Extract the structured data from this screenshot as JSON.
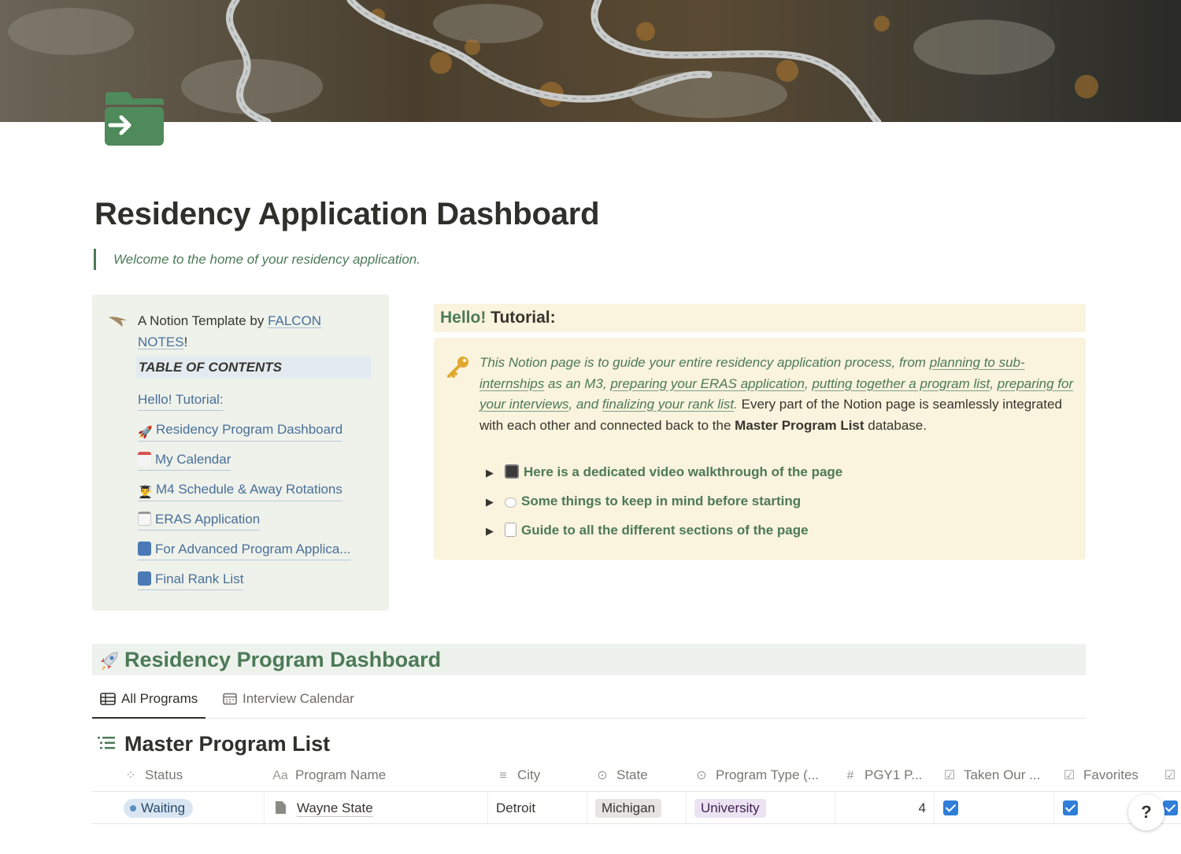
{
  "page": {
    "title": "Residency Application Dashboard",
    "quote": "Welcome to the home of your residency application."
  },
  "toc": {
    "credit_prefix": "A Notion Template by ",
    "credit_link": "FALCON NOTES",
    "credit_suffix": "!",
    "heading": "TABLE OF CONTENTS",
    "items": [
      {
        "label": "Hello! Tutorial:",
        "icon": ""
      },
      {
        "label": "Residency Program Dashboard",
        "icon": "rocket-icon"
      },
      {
        "label": "My Calendar",
        "icon": "calendar-icon"
      },
      {
        "label": "M4 Schedule & Away Rotations",
        "icon": "student-icon"
      },
      {
        "label": "ERAS Application",
        "icon": "notepad-icon"
      },
      {
        "label": "For Advanced Program Applica...",
        "icon": "bar-chart-icon"
      },
      {
        "label": "Final Rank List",
        "icon": "numbers-icon"
      }
    ]
  },
  "tutorial": {
    "heading_green": "Hello!",
    "heading_rest": " Tutorial:",
    "callout": {
      "intro": "This Notion page is to guide your entire residency application process, from ",
      "link1": "planning to sub-internships",
      "t2": " as an M3, ",
      "link2": "preparing your ERAS application",
      "t3": ", ",
      "link3": "putting together a program list",
      "t4": ", ",
      "link4": "preparing for your interviews",
      "t5": ", and ",
      "link5": "finalizing your rank list",
      "t6": ".",
      "plain": " Every part of the Notion page is seamlessly integrated with each other and connected back to the ",
      "bold": "Master Program List",
      "end": " database."
    },
    "toggles": [
      {
        "label": "Here is a dedicated video walkthrough of the page",
        "icon": "tv-icon"
      },
      {
        "label": "Some things to keep in mind before starting",
        "icon": "thought-bubble-icon"
      },
      {
        "label": "Guide to all the different sections of the page",
        "icon": "document-icon"
      }
    ]
  },
  "dashboard": {
    "title": "Residency Program Dashboard",
    "tabs": [
      "All Programs",
      "Interview Calendar"
    ],
    "database_title": "Master Program List",
    "columns": [
      {
        "label": "Status",
        "icon": "status-icon"
      },
      {
        "label": "Program Name",
        "icon": "text-icon"
      },
      {
        "label": "City",
        "icon": "lines-icon"
      },
      {
        "label": "State",
        "icon": "select-icon"
      },
      {
        "label": "Program Type (...",
        "icon": "select-icon"
      },
      {
        "label": "PGY1 P...",
        "icon": "number-icon"
      },
      {
        "label": "Taken Our ...",
        "icon": "checkbox-icon"
      },
      {
        "label": "Favorites",
        "icon": "checkbox-icon"
      }
    ],
    "rows": [
      {
        "status": "Waiting",
        "program_name": "Wayne State",
        "city": "Detroit",
        "state": "Michigan",
        "program_type": "University",
        "pgy1": "4",
        "taken": true,
        "favorites": true
      }
    ]
  },
  "help_label": "?",
  "colors": {
    "accent_green": "#4c7a57",
    "link_blue": "#4a6f99",
    "callout_bg": "#faf3dd",
    "toc_bg": "#eef2eb",
    "checkbox_blue": "#2f7ed8"
  }
}
